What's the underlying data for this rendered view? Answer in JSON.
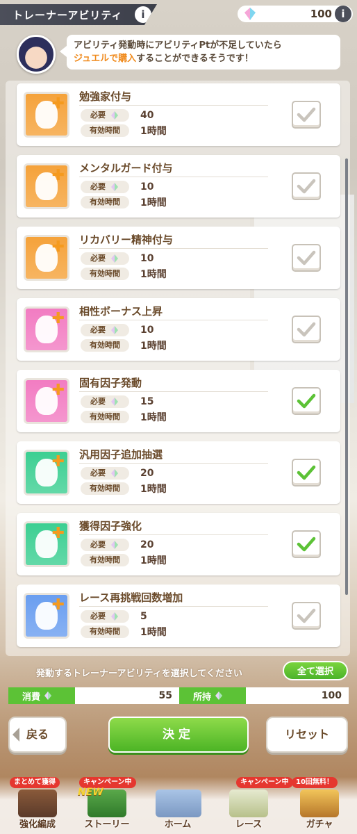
{
  "header": {
    "title": "トレーナーアビリティ",
    "info_icon": "i",
    "jewel_count": "100",
    "jewel_info_icon": "i"
  },
  "tip": {
    "line1": "アビリティ発動時にアビリティPtが不足していたら",
    "line2_highlight": "ジュエルで購入",
    "line2_rest": "することができるそうです！"
  },
  "labels": {
    "required": "必要",
    "duration": "有効時間"
  },
  "abilities": [
    {
      "name": "勉強家付与",
      "cost": "40",
      "duration": "1時間",
      "checked": false,
      "icon_color": "#f5a23a"
    },
    {
      "name": "メンタルガード付与",
      "cost": "10",
      "duration": "1時間",
      "checked": false,
      "icon_color": "#f5a23a"
    },
    {
      "name": "リカバリー精神付与",
      "cost": "10",
      "duration": "1時間",
      "checked": false,
      "icon_color": "#f5a23a"
    },
    {
      "name": "相性ボーナス上昇",
      "cost": "10",
      "duration": "1時間",
      "checked": false,
      "icon_color": "#f27cc2"
    },
    {
      "name": "固有因子発動",
      "cost": "15",
      "duration": "1時間",
      "checked": true,
      "icon_color": "#f27cc2"
    },
    {
      "name": "汎用因子追加抽選",
      "cost": "20",
      "duration": "1時間",
      "checked": true,
      "icon_color": "#3ccf92"
    },
    {
      "name": "獲得因子強化",
      "cost": "20",
      "duration": "1時間",
      "checked": true,
      "icon_color": "#3ccf92"
    },
    {
      "name": "レース再挑戦回数増加",
      "cost": "5",
      "duration": "1時間",
      "checked": false,
      "icon_color": "#6a9ef0"
    }
  ],
  "footer": {
    "prompt": "発動するトレーナーアビリティを選択してください",
    "select_all": "全て選択",
    "consume_label": "消費",
    "consume_value": "55",
    "have_label": "所持",
    "have_value": "100",
    "back": "戻る",
    "confirm": "決定",
    "reset": "リセット"
  },
  "nav": [
    {
      "label": "強化編成",
      "badge": "まとめて獲得"
    },
    {
      "label": "ストーリー",
      "badge": "キャンペーン中",
      "extra": "NEW"
    },
    {
      "label": "ホーム",
      "badge": ""
    },
    {
      "label": "レース",
      "badge": "キャンペーン中"
    },
    {
      "label": "ガチャ",
      "badge": "10回無料！"
    }
  ],
  "colors": {
    "accent_green": "#4cb425",
    "highlight_orange": "#f08a1c",
    "check_on": "#5cc236",
    "check_off": "#c9c4bc"
  }
}
